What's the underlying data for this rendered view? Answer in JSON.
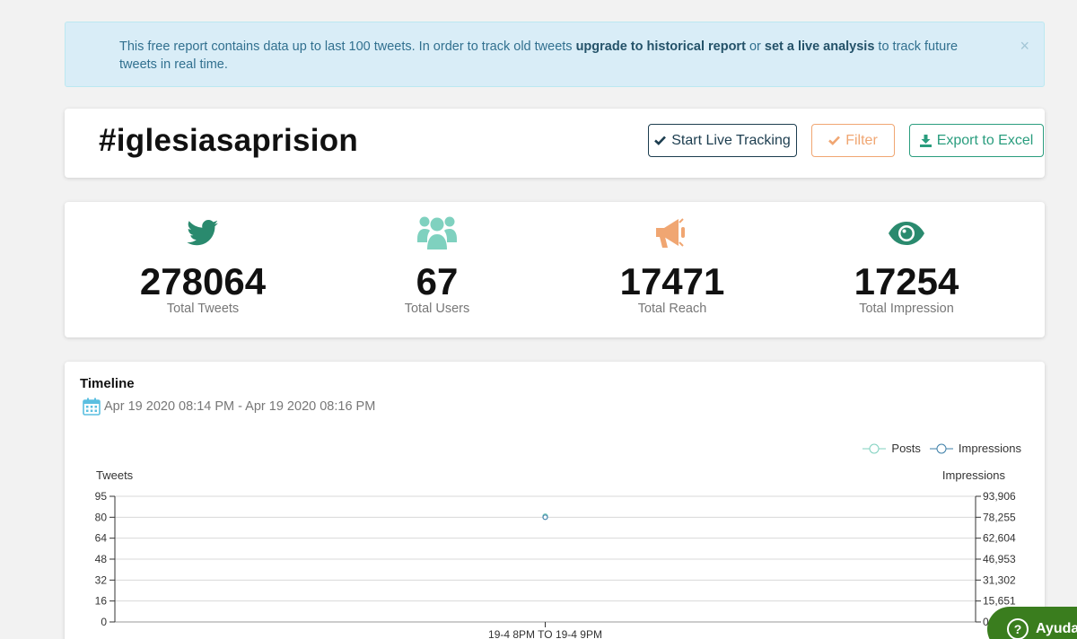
{
  "alert": {
    "text_1": "This free report contains data up to last 100 tweets. In order to track old tweets ",
    "link_1": "upgrade to historical report",
    "text_2": " or ",
    "link_2": "set a live analysis",
    "text_3": " to track future tweets in real time.",
    "close": "×"
  },
  "header": {
    "hashtag": "#iglesiasaprision",
    "live_label": "Start Live Tracking",
    "filter_label": "Filter",
    "export_label": "Export to Excel"
  },
  "stats": [
    {
      "icon": "twitter-icon",
      "value": "278064",
      "label": "Total Tweets",
      "color": "#2a8a6e"
    },
    {
      "icon": "users-icon",
      "value": "67",
      "label": "Total Users",
      "color": "#7fd1bf"
    },
    {
      "icon": "megaphone-icon",
      "value": "17471",
      "label": "Total Reach",
      "color": "#f0a672"
    },
    {
      "icon": "eye-icon",
      "value": "17254",
      "label": "Total Impression",
      "color": "#2a8a6e"
    }
  ],
  "timeline": {
    "title": "Timeline",
    "date_range": "Apr 19 2020 08:14 PM - Apr 19 2020 08:16 PM"
  },
  "chart_data": {
    "type": "line",
    "title": "",
    "ylabel": "Tweets",
    "y2label": "Impressions",
    "categories": [
      "19-4 8PM TO 19-4 9PM"
    ],
    "y_ticks": [
      "95",
      "80",
      "64",
      "48",
      "32",
      "16",
      "0"
    ],
    "y2_ticks": [
      "93,906",
      "78,255",
      "62,604",
      "46,953",
      "31,302",
      "15,651",
      "0"
    ],
    "ylim": [
      0,
      95
    ],
    "y2lim": [
      0,
      93906
    ],
    "legend_position": "top-right",
    "grid": true,
    "series": [
      {
        "name": "Posts",
        "axis": "left",
        "values": [
          80
        ],
        "color": "#7fd1bf"
      },
      {
        "name": "Impressions",
        "axis": "right",
        "values": [
          78255
        ],
        "color": "#3d7fa8"
      }
    ]
  },
  "help": {
    "label": "Ayuda",
    "icon": "?"
  }
}
